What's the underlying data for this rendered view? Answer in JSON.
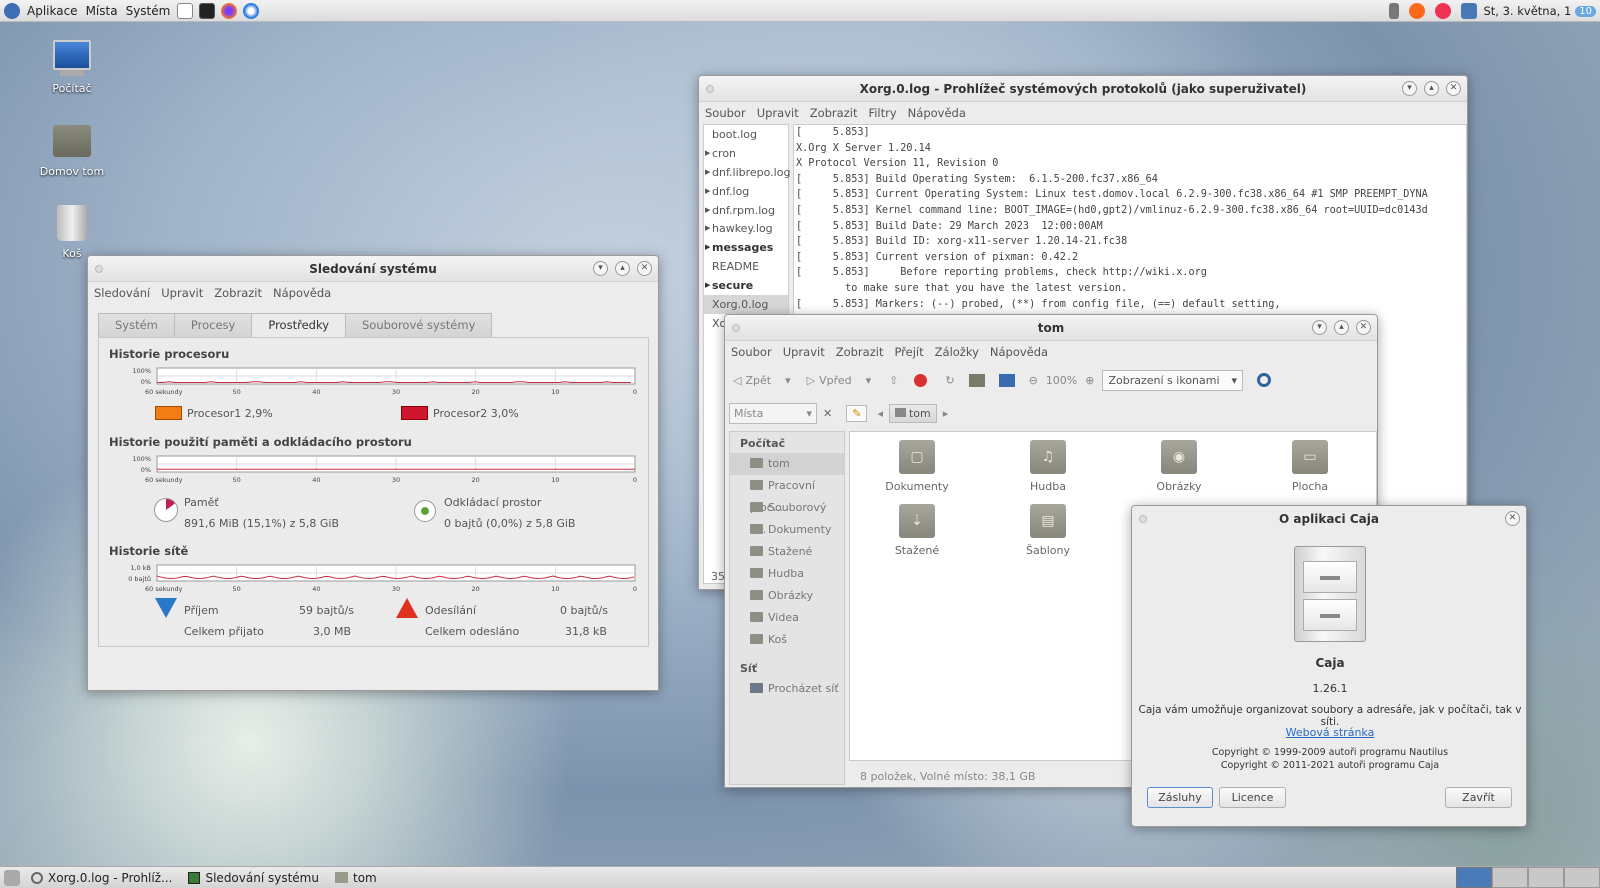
{
  "topbar": {
    "menus": [
      "Aplikace",
      "Místa",
      "Systém"
    ],
    "clock": "St, 3. května, 1",
    "badge": "10"
  },
  "desktop": {
    "icons": [
      {
        "label": "Počítač"
      },
      {
        "label": "Domov tom"
      },
      {
        "label": "Koš"
      }
    ]
  },
  "taskbar": {
    "items": [
      "Xorg.0.log - Prohlíž...",
      "Sledování systému",
      "tom"
    ]
  },
  "logviewer": {
    "title": "Xorg.0.log - Prohlížeč systémových protokolů (jako superuživatel)",
    "menu": [
      "Soubor",
      "Upravit",
      "Zobrazit",
      "Filtry",
      "Nápověda"
    ],
    "files": [
      {
        "name": "boot.log",
        "arrow": false,
        "bold": false
      },
      {
        "name": "cron",
        "arrow": true,
        "bold": false
      },
      {
        "name": "dnf.librepo.log",
        "arrow": true,
        "bold": false
      },
      {
        "name": "dnf.log",
        "arrow": true,
        "bold": false
      },
      {
        "name": "dnf.rpm.log",
        "arrow": true,
        "bold": false
      },
      {
        "name": "hawkey.log",
        "arrow": true,
        "bold": false
      },
      {
        "name": "messages",
        "arrow": true,
        "bold": true
      },
      {
        "name": "README",
        "arrow": false,
        "bold": false
      },
      {
        "name": "secure",
        "arrow": true,
        "bold": true
      },
      {
        "name": "Xorg.0.log",
        "arrow": false,
        "bold": false,
        "selected": true
      },
      {
        "name": "Xo",
        "arrow": false,
        "bold": false
      }
    ],
    "lines": [
      "[     5.853]",
      "X.Org X Server 1.20.14",
      "X Protocol Version 11, Revision 0",
      "[     5.853] Build Operating System:  6.1.5-200.fc37.x86_64",
      "[     5.853] Current Operating System: Linux test.domov.local 6.2.9-300.fc38.x86_64 #1 SMP PREEMPT_DYNA",
      "[     5.853] Kernel command line: BOOT_IMAGE=(hd0,gpt2)/vmlinuz-6.2.9-300.fc38.x86_64 root=UUID=dc0143d",
      "[     5.853] Build Date: 29 March 2023  12:00:00AM",
      "[     5.853] Build ID: xorg-x11-server 1.20.14-21.fc38",
      "[     5.853] Current version of pixman: 0.42.2",
      "[     5.853]     Before reporting problems, check http://wiki.x.org",
      "        to make sure that you have the latest version.",
      "[     5.853] Markers: (--) probed, (**) from config file, (==) default setting,"
    ],
    "status": "35"
  },
  "monitor": {
    "title": "Sledování systému",
    "menu": [
      "Sledování",
      "Upravit",
      "Zobrazit",
      "Nápověda"
    ],
    "tabs": [
      "Systém",
      "Procesy",
      "Prostředky",
      "Souborové systémy"
    ],
    "active_tab": 2,
    "cpu": {
      "heading": "Historie procesoru",
      "ytop": "100%",
      "ybot": "0%",
      "xlabels": [
        "60 sekundy",
        "50",
        "40",
        "30",
        "20",
        "10",
        "0"
      ],
      "p1": "Procesor1  2,9%",
      "p2": "Procesor2  3,0%",
      "c1": "#f47c16",
      "c2": "#d0162e"
    },
    "mem": {
      "heading": "Historie použití paměti a odkládacího prostoru",
      "ytop": "100%",
      "ybot": "0%",
      "mem_label": "Paměť",
      "mem_value": "891,6 MiB (15,1%) z 5,8 GiB",
      "swap_label": "Odkládací prostor",
      "swap_value": "0 bajtů (0,0%) z 5,8 GiB"
    },
    "net": {
      "heading": "Historie sítě",
      "ytop": "1,0 kB",
      "ybot": "0 bajtů",
      "rx_label": "Příjem",
      "rx_rate": "59 bajtů/s",
      "rx_total_label": "Celkem přijato",
      "rx_total": "3,0 MB",
      "tx_label": "Odesílání",
      "tx_rate": "0 bajtů/s",
      "tx_total_label": "Celkem odesláno",
      "tx_total": "31,8 kB"
    }
  },
  "caja": {
    "title": "tom",
    "menu": [
      "Soubor",
      "Upravit",
      "Zobrazit",
      "Přejít",
      "Záložky",
      "Nápověda"
    ],
    "back": "Zpět",
    "forward": "Vpřed",
    "zoom": "100%",
    "view": "Zobrazení s ikonami",
    "places": "Místa",
    "crumb": "tom",
    "side_computer": "Počítač",
    "side_items": [
      "tom",
      "Pracovní ploc...",
      "Souborový s...",
      "Dokumenty",
      "Stažené",
      "Hudba",
      "Obrázky",
      "Videa",
      "Koš"
    ],
    "side_network": "Síť",
    "side_net_items": [
      "Procházet síť"
    ],
    "files": [
      "Dokumenty",
      "Hudba",
      "Obrázky",
      "Plocha",
      "Stažené",
      "Šablony"
    ],
    "status": "8 položek, Volné místo: 38,1 GB"
  },
  "about": {
    "title": "O aplikaci Caja",
    "name": "Caja",
    "version": "1.26.1",
    "desc": "Caja vám umožňuje organizovat soubory a adresáře, jak v počítači, tak v síti.",
    "link": "Webová stránka",
    "copy1": "Copyright © 1999-2009 autoři programu Nautilus",
    "copy2": "Copyright © 2011-2021 autoři programu Caja",
    "btn_credits": "Zásluhy",
    "btn_license": "Licence",
    "btn_close": "Zavřít"
  }
}
